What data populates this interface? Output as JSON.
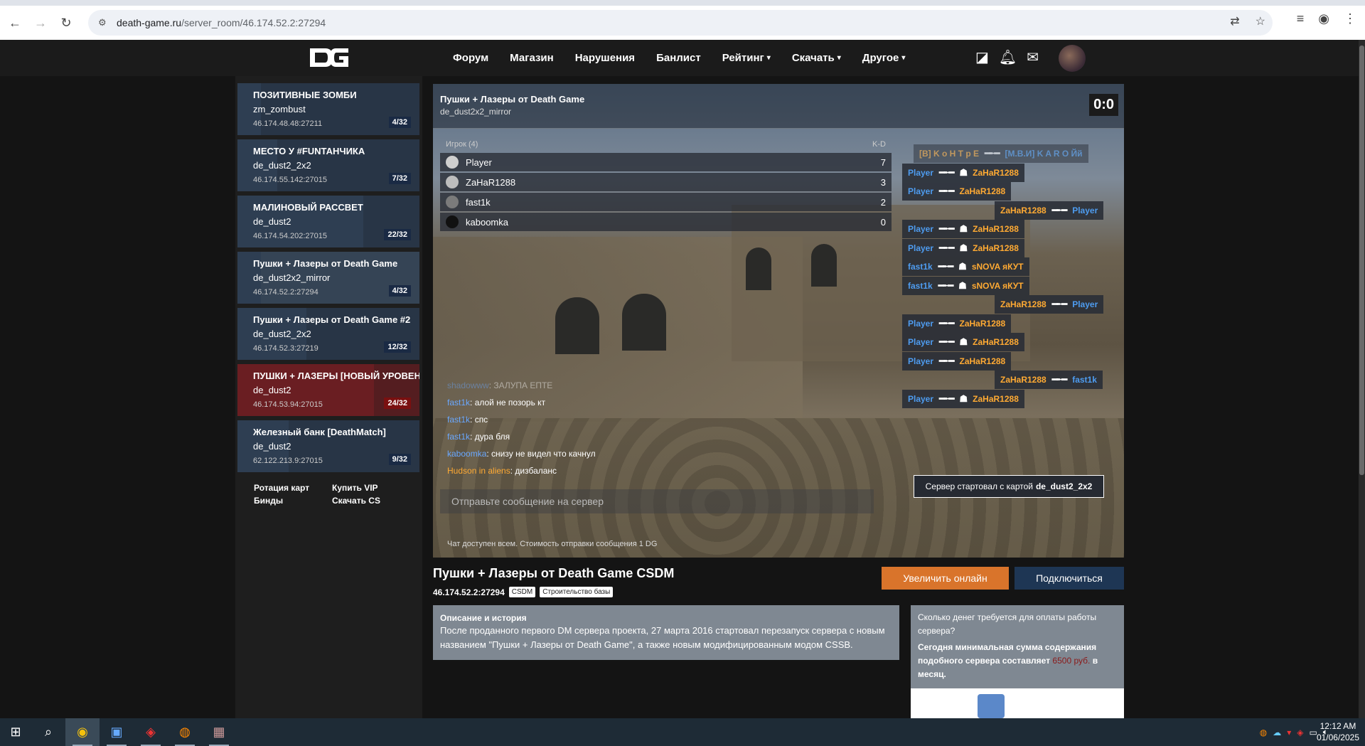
{
  "browser": {
    "url_host": "death-game.ru",
    "url_path": "/server_room/46.174.52.2:27294"
  },
  "nav": {
    "items": [
      "Форум",
      "Магазин",
      "Нарушения",
      "Банлист",
      "Рейтинг",
      "Скачать",
      "Другое"
    ]
  },
  "servers": [
    {
      "name": "ПОЗИТИВНЫЕ ЗОМБИ",
      "map": "zm_zombust",
      "ip": "46.174.48.48:27211",
      "count": "4/32",
      "fill": 0.125
    },
    {
      "name": "МЕСТО У #FUNТАНЧИКА",
      "map": "de_dust2_2x2",
      "ip": "46.174.55.142:27015",
      "count": "7/32",
      "fill": 0.22
    },
    {
      "name": "МАЛИНОВЫЙ РАССВЕТ",
      "map": "de_dust2",
      "ip": "46.174.54.202:27015",
      "count": "22/32",
      "fill": 0.69
    },
    {
      "name": "Пушки + Лазеры от Death Game",
      "map": "de_dust2x2_mirror",
      "ip": "46.174.52.2:27294",
      "count": "4/32",
      "fill": 0.125
    },
    {
      "name": "Пушки + Лазеры от Death Game #2",
      "map": "de_dust2_2x2",
      "ip": "46.174.52.3:27219",
      "count": "12/32",
      "fill": 0.375
    },
    {
      "name": "ПУШКИ + ЛАЗЕРЫ [НОВЫЙ УРОВЕНЬ]",
      "map": "de_dust2",
      "ip": "46.174.53.94:27015",
      "count": "24/32",
      "fill": 0.75
    },
    {
      "name": "Железный банк [DeathMatch]",
      "map": "de_dust2",
      "ip": "62.122.213.9:27015",
      "count": "9/32",
      "fill": 0.28
    }
  ],
  "side_links": [
    "Ротация карт",
    "Купить VIP",
    "Бинды",
    "Скачать CS"
  ],
  "game": {
    "title": "Пушки + Лазеры от Death Game",
    "map": "de_dust2x2_mirror",
    "score": "0:0",
    "players_header": "Игрок (4)",
    "kd_header": "K-D",
    "players": [
      {
        "name": "Player",
        "kd": "7"
      },
      {
        "name": "ZaHaR1288",
        "kd": "3"
      },
      {
        "name": "fast1k",
        "kd": "2"
      },
      {
        "name": "kaboomka",
        "kd": "0"
      }
    ],
    "kills": [
      {
        "killer": "[B] K o H T p E",
        "victim": "[M.B.И] K A R O Йй",
        "killer_color": "orange",
        "victim_color": "blue",
        "hs": false,
        "faded": true
      },
      {
        "killer": "Player",
        "victim": "ZaHaR1288",
        "killer_color": "blue",
        "victim_color": "orange",
        "hs": true
      },
      {
        "killer": "Player",
        "victim": "ZaHaR1288",
        "killer_color": "blue",
        "victim_color": "orange",
        "hs": false
      },
      {
        "killer": "ZaHaR1288",
        "victim": "Player",
        "killer_color": "orange",
        "victim_color": "blue",
        "hs": false
      },
      {
        "killer": "Player",
        "victim": "ZaHaR1288",
        "killer_color": "blue",
        "victim_color": "orange",
        "hs": true
      },
      {
        "killer": "Player",
        "victim": "ZaHaR1288",
        "killer_color": "blue",
        "victim_color": "orange",
        "hs": true
      },
      {
        "killer": "fast1k",
        "victim": "sNOVA яКУТ",
        "killer_color": "blue",
        "victim_color": "orange",
        "hs": true
      },
      {
        "killer": "fast1k",
        "victim": "sNOVA яКУТ",
        "killer_color": "blue",
        "victim_color": "orange",
        "hs": true
      },
      {
        "killer": "ZaHaR1288",
        "victim": "Player",
        "killer_color": "orange",
        "victim_color": "blue",
        "hs": false
      },
      {
        "killer": "Player",
        "victim": "ZaHaR1288",
        "killer_color": "blue",
        "victim_color": "orange",
        "hs": false
      },
      {
        "killer": "Player",
        "victim": "ZaHaR1288",
        "killer_color": "blue",
        "victim_color": "orange",
        "hs": true
      },
      {
        "killer": "Player",
        "victim": "ZaHaR1288",
        "killer_color": "blue",
        "victim_color": "orange",
        "hs": false
      },
      {
        "killer": "ZaHaR1288",
        "victim": "fast1k",
        "killer_color": "orange",
        "victim_color": "blue",
        "hs": false
      },
      {
        "killer": "Player",
        "victim": "ZaHaR1288",
        "killer_color": "blue",
        "victim_color": "orange",
        "hs": true
      }
    ],
    "system_prefix": "Сервер стартовал с картой",
    "system_map": "de_dust2_2x2",
    "chat": [
      {
        "nick": "shadowww",
        "text": "ЗАЛУПА ЕПТЕ",
        "faded": true
      },
      {
        "nick": "fast1k",
        "text": "алой не позорь кт"
      },
      {
        "nick": "fast1k",
        "text": "спс"
      },
      {
        "nick": "fast1k",
        "text": "дура бля"
      },
      {
        "nick": "kaboomka",
        "text": "снизу не видел что качнул"
      },
      {
        "nick": "Hudson in aliens",
        "text": "дизбаланс",
        "orange": true
      }
    ],
    "chat_placeholder": "Отправьте сообщение на сервер",
    "chat_note": "Чат доступен всем. Стоимость отправки сообщения 1 DG"
  },
  "server_info": {
    "title": "Пушки + Лазеры от Death Game CSDM",
    "ip": "46.174.52.2:27294",
    "tags": [
      "CSDM",
      "Строительство базы"
    ],
    "boost_label": "Увеличить онлайн",
    "connect_label": "Подключиться",
    "desc_heading": "Описание и история",
    "desc_text": "После проданного первого DM сервера проекта, 27 марта 2016 стартовал перезапуск сервера с новым названием \"Пушки + Лазеры от Death Game\", а также новым модифицированным модом CSSB.",
    "cost_question": "Сколько денег требуется для оплаты работы сервера?",
    "cost_answer_pre": "Сегодня минимальная сумма содержания подобного сервера составляет",
    "cost_money": "6500 руб.",
    "cost_answer_post": "в месяц."
  },
  "taskbar": {
    "time": "12:12 AM",
    "date": "01/06/2025"
  }
}
